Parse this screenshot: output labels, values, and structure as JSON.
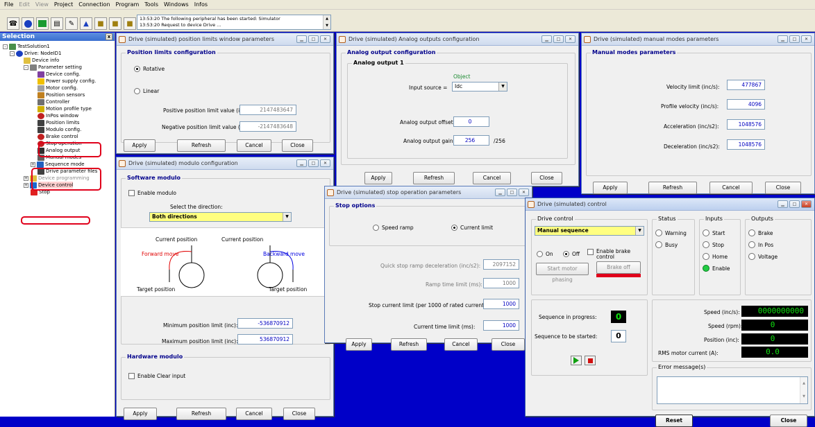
{
  "menu": [
    "File",
    "Edit",
    "View",
    "Project",
    "Connection",
    "Program",
    "Tools",
    "Windows",
    "Infos"
  ],
  "log": {
    "line1": "13:53:20 The following peripheral has been started: Simulator",
    "line2": "13:53:20 Request to device Drive ..."
  },
  "selection": {
    "title": "Selection",
    "close": "x",
    "tree": [
      "TestSolution1",
      "Drive: NodeID1",
      "Device info",
      "Parameter setting",
      "Device config.",
      "Power supply config.",
      "Motor config.",
      "Position sensors",
      "Controller",
      "Motion profile type",
      "InPos window",
      "Position limits",
      "Modulo config.",
      "Brake control",
      "Stop operation",
      "Analog output",
      "Manual modes",
      "Sequence mode",
      "Drive parameter files",
      "Device programming",
      "Device control",
      "Stop"
    ]
  },
  "win_poslimits": {
    "title": "Drive (simulated) position limits window parameters",
    "group": "Position limits configuration",
    "rotative": "Rotative",
    "linear": "Linear",
    "pos_label": "Positive position limit value (inc):",
    "pos_value": "2147483647",
    "neg_label": "Negative position limit value (inc):",
    "neg_value": "-2147483648",
    "apply": "Apply",
    "refresh": "Refresh",
    "cancel": "Cancel",
    "close": "Close"
  },
  "win_analog": {
    "title": "Drive (simulated) Analog outputs configuration",
    "group": "Analog output configuration",
    "sub": "Analog output 1",
    "object": "Object",
    "input_label": "Input source =",
    "input_value": "Idc",
    "offset_label": "Analog output offset:",
    "offset_value": "0",
    "gain_label": "Analog output gain:",
    "gain_value": "256",
    "gain_unit": "/256",
    "apply": "Apply",
    "refresh": "Refresh",
    "cancel": "Cancel",
    "close": "Close"
  },
  "win_manual": {
    "title": "Drive (simulated) manual modes parameters",
    "group": "Manual modes parameters",
    "vel_label": "Velocity limit (inc/s):",
    "vel_value": "477867",
    "prof_label": "Profile velocity (inc/s):",
    "prof_value": "4096",
    "acc_label": "Acceleration (inc/s2):",
    "acc_value": "1048576",
    "dec_label": "Deceleration (inc/s2):",
    "dec_value": "1048576",
    "apply": "Apply",
    "refresh": "Refresh",
    "cancel": "Cancel",
    "close": "Close"
  },
  "win_modulo": {
    "title": "Drive (simulated) modulo configuration",
    "group": "Software modulo",
    "enable": "Enable modulo",
    "dir_label": "Select the direction:",
    "dir_value": "Both directions",
    "cur1": "Current position",
    "cur2": "Current position",
    "fwd": "Forward move",
    "bwd": "Backward move",
    "tgt1": "Target position",
    "tgt2": "Target position",
    "min_label": "Minimum position limit (inc):",
    "min_value": "-536870912",
    "max_label": "Maximum position limit (inc):",
    "max_value": "536870912",
    "hw_group": "Hardware modulo",
    "hw_enable": "Enable Clear input",
    "apply": "Apply",
    "refresh": "Refresh",
    "cancel": "Cancel",
    "close": "Close"
  },
  "win_stop": {
    "title": "Drive (simulated) stop operation parameters",
    "group": "Stop options",
    "speed_ramp": "Speed ramp",
    "current_limit": "Current limit",
    "qs_label": "Quick stop ramp deceleration (inc/s2):",
    "qs_value": "2097152",
    "ramp_label": "Ramp time limit (ms):",
    "ramp_value": "1000",
    "scl_label": "Stop current limit (per 1000 of rated current):",
    "scl_value": "1000",
    "ctl_label": "Current time limit (ms):",
    "ctl_value": "1000",
    "apply": "Apply",
    "refresh": "Refresh",
    "cancel": "Cancel",
    "close": "Close"
  },
  "win_control": {
    "title": "Drive (simulated) control",
    "dc_group": "Drive control",
    "mode": "Manual sequence",
    "on": "On",
    "off": "Off",
    "enable_brake": "Enable brake control",
    "start_phasing": "Start motor phasing",
    "brake_off": "Brake off",
    "seq_progress_label": "Sequence in progress:",
    "seq_progress": "0",
    "seq_start_label": "Sequence to be started:",
    "seq_start": "0",
    "status_group": "Status",
    "warning": "Warning",
    "busy": "Busy",
    "inputs_group": "Inputs",
    "start": "Start",
    "stop": "Stop",
    "home": "Home",
    "enable": "Enable",
    "outputs_group": "Outputs",
    "brake": "Brake",
    "inpos": "In Pos",
    "voltage": "Voltage",
    "speed_incs_label": "Speed (inc/s):",
    "speed_incs": "0000000000",
    "speed_rpm_label": "Speed (rpm):",
    "speed_rpm": "0",
    "position_label": "Position (inc):",
    "position": "0",
    "rms_label": "RMS motor current (A):",
    "rms": "0.0",
    "error_group": "Error message(s)",
    "reset": "Reset",
    "close": "Close",
    "accent_red": "#e0001b",
    "led_green": "#22cc44"
  }
}
